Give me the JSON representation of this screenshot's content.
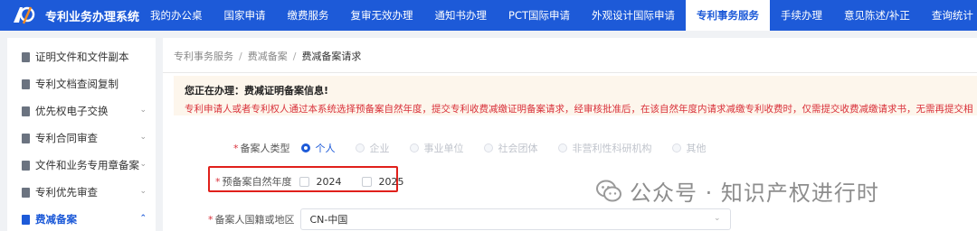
{
  "app": {
    "title": "专利业务办理系统"
  },
  "nav": {
    "items": [
      {
        "label": "我的办公桌",
        "active": false
      },
      {
        "label": "国家申请",
        "active": false
      },
      {
        "label": "缴费服务",
        "active": false
      },
      {
        "label": "复审无效办理",
        "active": false
      },
      {
        "label": "通知书办理",
        "active": false
      },
      {
        "label": "PCT国际申请",
        "active": false
      },
      {
        "label": "外观设计国际申请",
        "active": false
      },
      {
        "label": "专利事务服务",
        "active": true
      },
      {
        "label": "手续办理",
        "active": false
      },
      {
        "label": "意见陈述/补正",
        "active": false
      },
      {
        "label": "查询统计",
        "active": false
      }
    ]
  },
  "sidebar": {
    "items": [
      {
        "label": "证明文件和文件副本",
        "expandable": false,
        "active": false
      },
      {
        "label": "专利文档查阅复制",
        "expandable": false,
        "active": false
      },
      {
        "label": "优先权电子交换",
        "expandable": true,
        "active": false
      },
      {
        "label": "专利合同审查",
        "expandable": true,
        "active": false
      },
      {
        "label": "文件和业务专用章备案",
        "expandable": true,
        "active": false
      },
      {
        "label": "专利优先审查",
        "expandable": true,
        "active": false
      },
      {
        "label": "费减备案",
        "expandable": true,
        "active": true
      }
    ]
  },
  "breadcrumb": {
    "items": [
      "专利事务服务",
      "费减备案",
      "费减备案请求"
    ],
    "separator": "/"
  },
  "notice": {
    "title": "您正在办理：费减证明备案信息!",
    "text": "专利申请人或者专利权人通过本系统选择预备案自然年度，提交专利收费减缴证明备案请求，经审核批准后，在该自然年度内请求减缴专利收费时，仅需提交收费减缴请求书，无需再提交相"
  },
  "form": {
    "required_mark": "*",
    "type_field": {
      "label": "备案人类型",
      "options": [
        {
          "label": "个人",
          "checked": true
        },
        {
          "label": "企业",
          "checked": false
        },
        {
          "label": "事业单位",
          "checked": false
        },
        {
          "label": "社会团体",
          "checked": false
        },
        {
          "label": "非营利性科研机构",
          "checked": false
        },
        {
          "label": "其他",
          "checked": false
        }
      ]
    },
    "year_field": {
      "label": "预备案自然年度",
      "options": [
        {
          "label": "2024",
          "checked": false
        },
        {
          "label": "2025",
          "checked": false
        }
      ]
    },
    "region_field": {
      "label": "备案人国籍或地区",
      "value": "CN-中国"
    }
  },
  "watermark": {
    "text": "公众号 · 知识产权进行时",
    "icon": "wechat-icon"
  },
  "colors": {
    "brand": "#1d5ad8",
    "danger": "#d9313a",
    "highlight_box": "#e0201b",
    "notice_bg": "#fdf6ec"
  }
}
